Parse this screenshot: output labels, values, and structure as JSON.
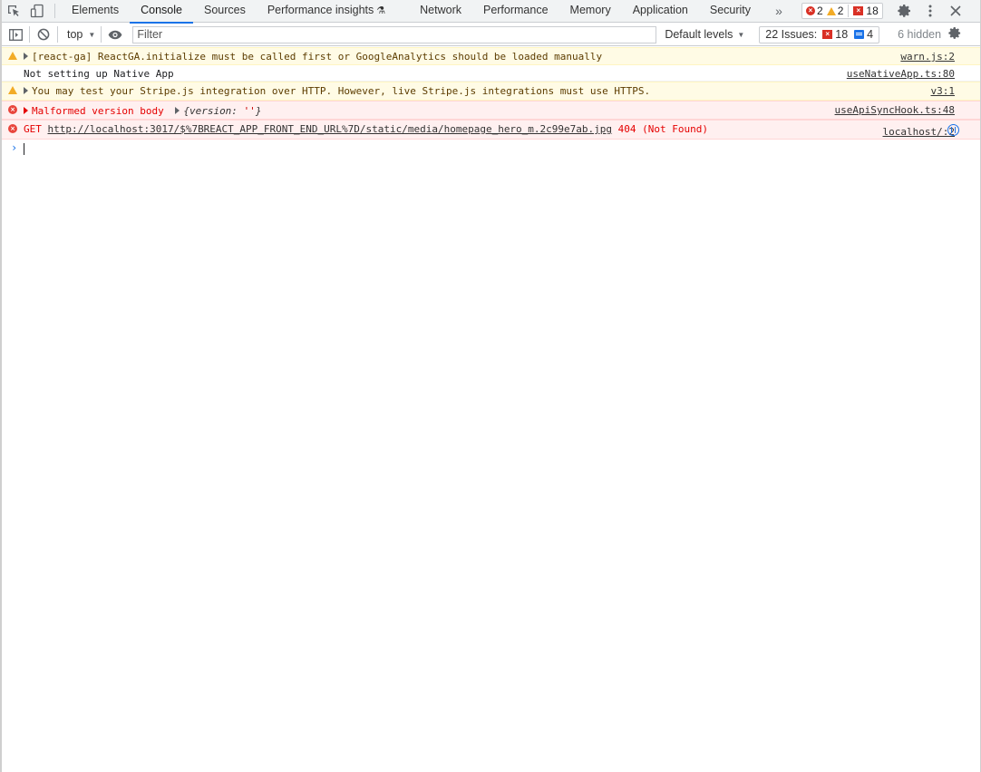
{
  "tabs": {
    "items": [
      {
        "label": "Elements"
      },
      {
        "label": "Console",
        "active": true
      },
      {
        "label": "Sources"
      },
      {
        "label": "Performance insights"
      },
      {
        "label": "Network"
      },
      {
        "label": "Performance"
      },
      {
        "label": "Memory"
      },
      {
        "label": "Application"
      },
      {
        "label": "Security"
      }
    ],
    "more_label": "»",
    "counters": {
      "errors": "2",
      "warnings": "2",
      "issues": "18"
    }
  },
  "toolbar": {
    "context": "top",
    "filter_placeholder": "Filter",
    "levels": "Default levels",
    "issues_label": "22 Issues:",
    "issues_errors": "18",
    "issues_info": "4",
    "hidden": "6 hidden"
  },
  "messages": [
    {
      "level": "warn",
      "text": "[react-ga] ReactGA.initialize must be called first or GoogleAnalytics should be loaded manually",
      "source": "warn.js:2"
    },
    {
      "level": "log",
      "text": "Not setting up Native App",
      "source": "useNativeApp.ts:80"
    },
    {
      "level": "warn",
      "text": "You may test your Stripe.js integration over HTTP. However, live Stripe.js integrations must use HTTPS.",
      "source": "v3:1"
    },
    {
      "level": "error",
      "text": "Malformed version body",
      "obj_key": "{version: ",
      "obj_val": "''",
      "obj_end": "}",
      "source": "useApiSyncHook.ts:48"
    },
    {
      "level": "error",
      "method": "GET",
      "url": "http://localhost:3017/$%7BREACT_APP_FRONT_END_URL%7D/static/media/homepage_hero_m.2c99e7ab.jpg",
      "status": "404 (Not Found)",
      "source": "localhost/:2"
    }
  ],
  "colors": {
    "accent": "#1a73e8",
    "error": "#e50000",
    "warning": "#f2ab26"
  }
}
